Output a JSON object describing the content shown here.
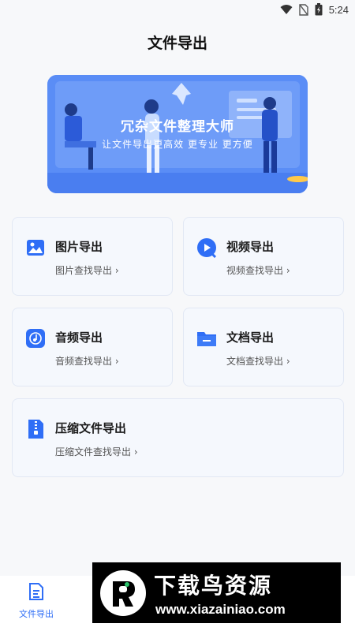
{
  "status_bar": {
    "time": "5:24"
  },
  "page_title": "文件导出",
  "banner": {
    "title": "冗杂文件整理大师",
    "subtitle": "让文件导出更高效 更专业 更方便"
  },
  "cards": {
    "images": {
      "title": "图片导出",
      "subtitle": "图片查找导出 ›",
      "icon": "image-icon"
    },
    "videos": {
      "title": "视频导出",
      "subtitle": "视频查找导出 ›",
      "icon": "video-play-icon"
    },
    "audio": {
      "title": "音频导出",
      "subtitle": "音频查找导出 ›",
      "icon": "music-note-icon"
    },
    "documents": {
      "title": "文档导出",
      "subtitle": "文档查找导出 ›",
      "icon": "folder-icon"
    },
    "archives": {
      "title": "压缩文件导出",
      "subtitle": "压缩文件查找导出 ›",
      "icon": "zip-file-icon"
    }
  },
  "bottom_nav": {
    "tabs": [
      {
        "label": "文件导出",
        "icon": "file-export-icon",
        "active": true
      }
    ]
  },
  "watermark": {
    "title": "下载鸟资源",
    "url": "www.xiazainiao.com"
  },
  "colors": {
    "accent": "#2f6ef6",
    "banner": "#5a8df6",
    "card_bg": "#f5f8fd"
  }
}
